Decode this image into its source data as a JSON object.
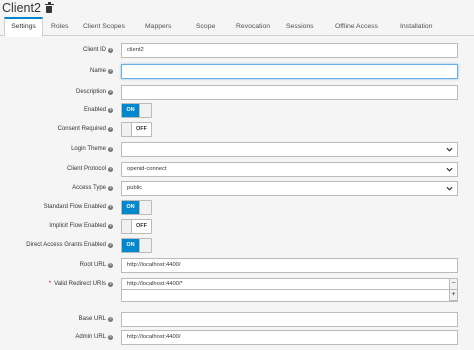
{
  "header": {
    "title": "Client2",
    "delete_icon": "trash-icon"
  },
  "tabs": [
    {
      "label": "Settings",
      "active": true
    },
    {
      "label": "Roles"
    },
    {
      "label": "Client Scopes"
    },
    {
      "label": "Mappers"
    },
    {
      "label": "Scope"
    },
    {
      "label": "Revocation"
    },
    {
      "label": "Sessions"
    },
    {
      "label": "Offline Access"
    },
    {
      "label": "Installation"
    }
  ],
  "form": {
    "client_id": {
      "label": "Client ID",
      "value": "client2"
    },
    "name": {
      "label": "Name",
      "value": ""
    },
    "description": {
      "label": "Description",
      "value": ""
    },
    "enabled": {
      "label": "Enabled",
      "state": "ON"
    },
    "consent_required": {
      "label": "Consent Required",
      "state": "OFF"
    },
    "login_theme": {
      "label": "Login Theme",
      "value": ""
    },
    "client_protocol": {
      "label": "Client Protocol",
      "value": "openid-connect"
    },
    "access_type": {
      "label": "Access Type",
      "value": "public"
    },
    "standard_flow": {
      "label": "Standard Flow Enabled",
      "state": "ON"
    },
    "implicit_flow": {
      "label": "Implicit Flow Enabled",
      "state": "OFF"
    },
    "direct_access": {
      "label": "Direct Access Grants Enabled",
      "state": "ON"
    },
    "root_url": {
      "label": "Root URL",
      "value": "http://localhost:4400/"
    },
    "redirect_uris": {
      "required_mark": "*",
      "label": "Valid Redirect URIs",
      "values": [
        "http://localhost:4400/*",
        ""
      ],
      "remove_symbol": "−",
      "add_symbol": "+"
    },
    "base_url": {
      "label": "Base URL",
      "value": ""
    },
    "admin_url": {
      "label": "Admin URL",
      "value": "http://localhost:4400/"
    },
    "help_symbol": "?"
  }
}
